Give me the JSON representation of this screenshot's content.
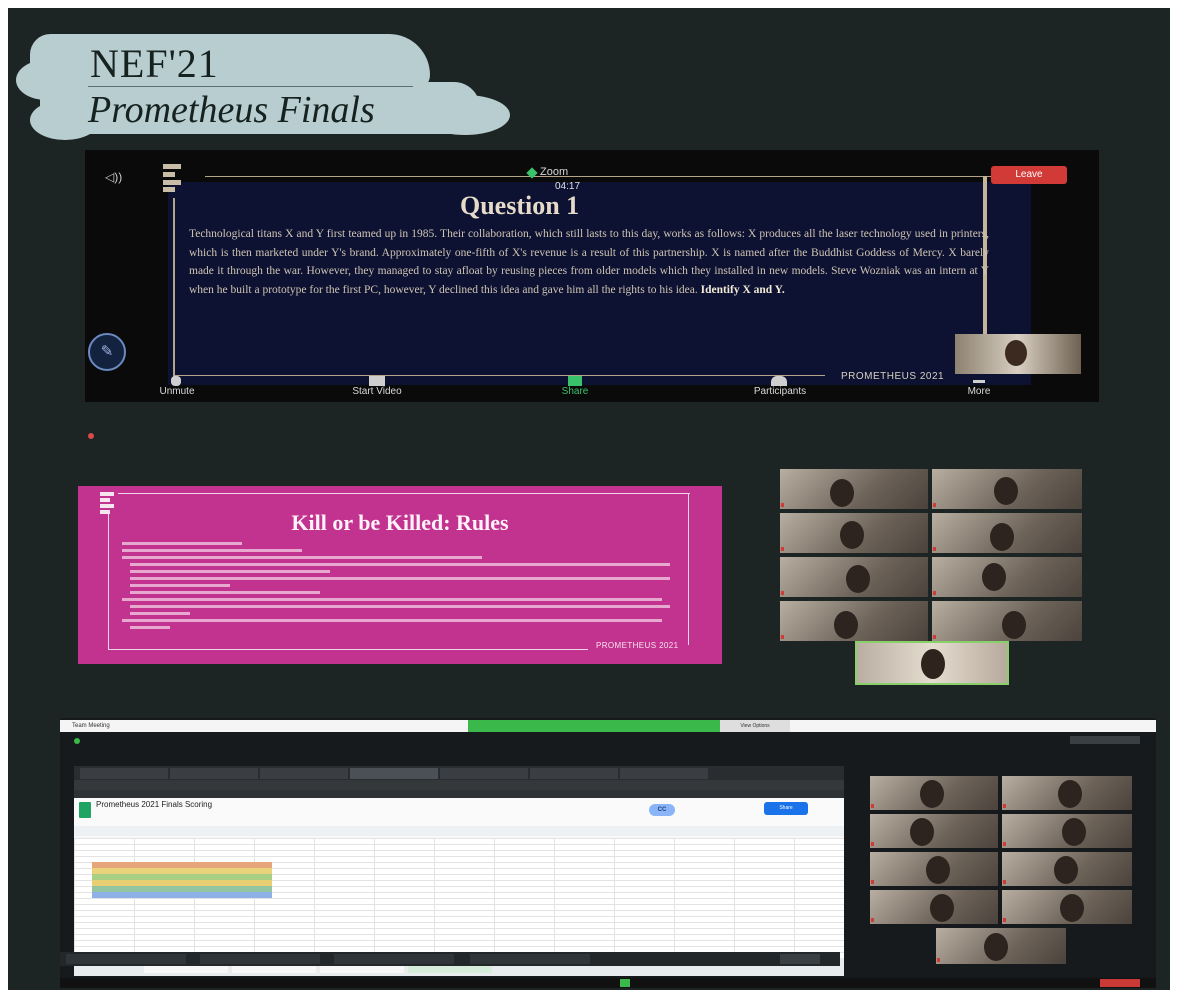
{
  "header": {
    "title": "NEF'21",
    "subtitle": "Prometheus Finals"
  },
  "zoom": {
    "app_label": "Zoom",
    "timer": "04:17",
    "leave_label": "Leave",
    "question_title": "Question 1",
    "question_text": "Technological titans X and Y first teamed up in 1985. Their collaboration, which still lasts to this day, works as follows: X produces all the laser technology used in printers, which is then marketed under Y's brand. Approximately one-fifth of X's revenue is a result of this partnership. X is named after the Buddhist Goddess of Mercy. X barely made it through the war. However, they managed to stay afloat by reusing pieces from older models which they installed in new models. Steve Wozniak was an intern at Y when he built a prototype for the first PC, however, Y declined this idea and gave him all the rights to his idea.",
    "question_prompt": "Identify X and Y.",
    "watermark": "PROMETHEUS 2021",
    "bottom_bar": {
      "unmute": "Unmute",
      "video": "Start Video",
      "share": "Share",
      "participants": "Participants",
      "more": "More"
    }
  },
  "rules_slide": {
    "title": "Kill or be Killed: Rules",
    "watermark": "PROMETHEUS 2021"
  },
  "desktop": {
    "window_title": "Team Meeting",
    "view_options": "View Options",
    "sheet_title": "Prometheus 2021 Finals Scoring",
    "share_label": "Share",
    "cc_badge": "CC"
  },
  "colors": {
    "background": "#1d2424",
    "title_cloud": "#b7cdcf",
    "rules_slide": "#c1338f",
    "leave_button": "#d13a37",
    "zoom_slide": "#0d1233",
    "sheet_green": "#1fa463"
  },
  "icons": [
    "speaker-icon",
    "pencil-icon",
    "mic-icon",
    "video-icon",
    "share-icon",
    "participants-icon",
    "more-icon"
  ]
}
